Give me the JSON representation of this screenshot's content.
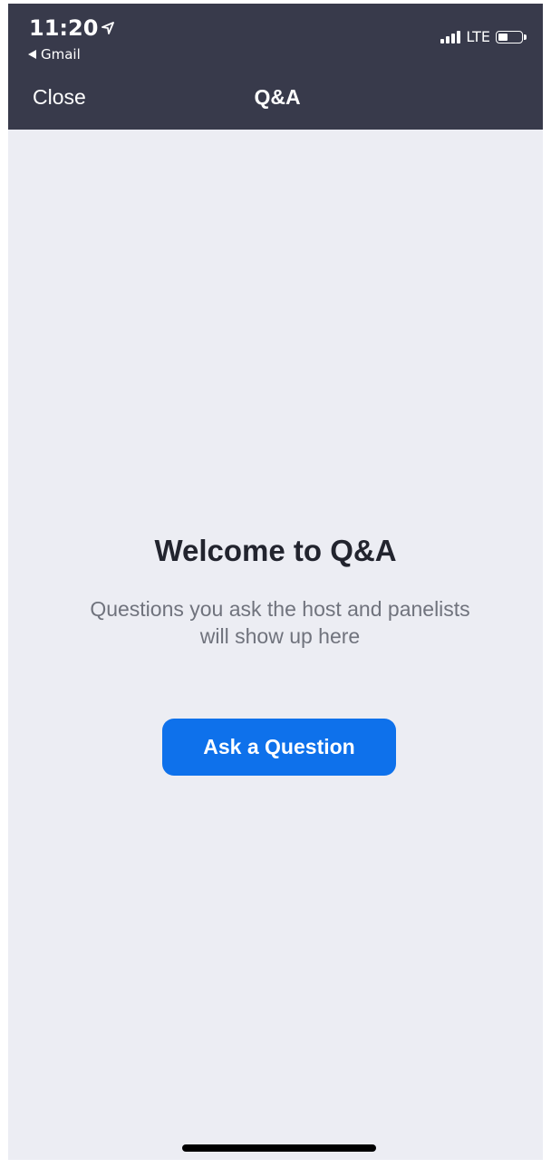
{
  "status_bar": {
    "time": "11:20",
    "back_app": "Gmail",
    "network": "LTE",
    "battery_level": 0.45,
    "icons": [
      "location-arrow-icon",
      "back-triangle-icon",
      "signal-bars-icon",
      "battery-icon"
    ]
  },
  "nav": {
    "close_label": "Close",
    "title": "Q&A"
  },
  "empty_state": {
    "title": "Welcome to Q&A",
    "subtitle_line1": "Questions you ask the host and panelists",
    "subtitle_line2": "will show up here",
    "button_label": "Ask a Question"
  },
  "colors": {
    "header_bg": "#383a4b",
    "content_bg": "#ecedf3",
    "accent": "#0e71eb"
  }
}
